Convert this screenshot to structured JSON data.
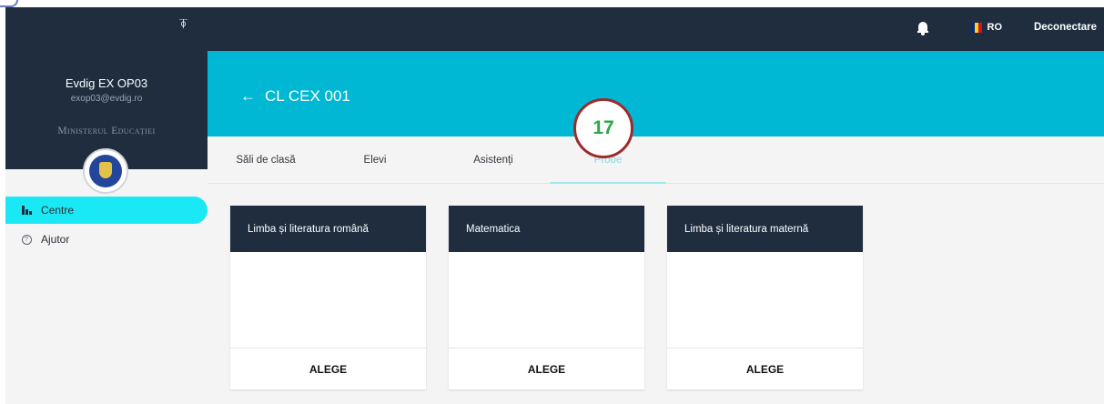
{
  "sidebar": {
    "user_name": "Evdig EX OP03",
    "user_email": "exop03@evdig.ro",
    "ministry": "Ministerul Educației",
    "items": [
      {
        "label": "Centre",
        "icon": "bar-chart-icon",
        "active": true
      },
      {
        "label": "Ajutor",
        "icon": "help-icon",
        "active": false
      }
    ]
  },
  "topbar": {
    "language": "RO",
    "logout_label": "Deconectare",
    "flag_colors": [
      "#002b7f",
      "#fcd116",
      "#ce1126"
    ]
  },
  "page": {
    "title": "CL CEX 001",
    "tabs": [
      {
        "label": "Săli de clasă",
        "active": false
      },
      {
        "label": "Elevi",
        "active": false
      },
      {
        "label": "Asistenți",
        "active": false
      },
      {
        "label": "Probe",
        "active": true
      }
    ],
    "annotation": "17",
    "cards": [
      {
        "title": "Limba și literatura română",
        "action": "ALEGE"
      },
      {
        "title": "Matematica",
        "action": "ALEGE"
      },
      {
        "title": "Limba și literatura maternă",
        "action": "ALEGE"
      }
    ]
  },
  "colors": {
    "navy": "#1f2d3f",
    "banner": "#00b8d4",
    "active_nav": "#1ae8f5",
    "active_tab_text": "#7fdde6",
    "annotation_border": "#9c2b2b",
    "annotation_text": "#27a844"
  }
}
